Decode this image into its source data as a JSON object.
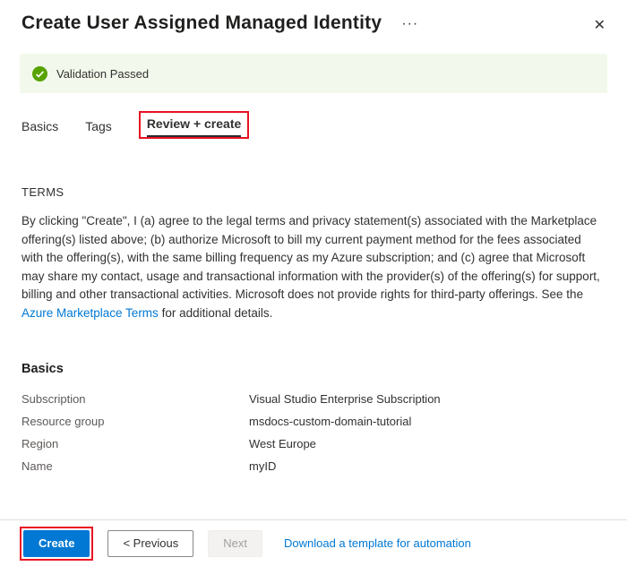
{
  "header": {
    "title": "Create User Assigned Managed Identity",
    "more_icon": "···",
    "close_icon": "✕"
  },
  "validation": {
    "message": "Validation Passed"
  },
  "tabs": [
    {
      "label": "Basics",
      "selected": false
    },
    {
      "label": "Tags",
      "selected": false
    },
    {
      "label": "Review + create",
      "selected": true
    }
  ],
  "terms": {
    "heading": "TERMS",
    "body_before_link": "By clicking \"Create\", I (a) agree to the legal terms and privacy statement(s) associated with the Marketplace offering(s) listed above; (b) authorize Microsoft to bill my current payment method for the fees associated with the offering(s), with the same billing frequency as my Azure subscription; and (c) agree that Microsoft may share my contact, usage and transactional information with the provider(s) of the offering(s) for support, billing and other transactional activities. Microsoft does not provide rights for third-party offerings. See the ",
    "link_text": "Azure Marketplace Terms",
    "body_after_link": " for additional details."
  },
  "basics": {
    "heading": "Basics",
    "rows": [
      {
        "label": "Subscription",
        "value": "Visual Studio Enterprise Subscription"
      },
      {
        "label": "Resource group",
        "value": "msdocs-custom-domain-tutorial"
      },
      {
        "label": "Region",
        "value": "West Europe"
      },
      {
        "label": "Name",
        "value": "myID"
      }
    ]
  },
  "footer": {
    "create_label": "Create",
    "previous_label": "< Previous",
    "next_label": "Next",
    "download_link": "Download a template for automation"
  },
  "colors": {
    "accent": "#0078d4",
    "success_icon": "#57a300",
    "success_background": "#f2f9ec",
    "annotation_highlight": "#e81123"
  }
}
